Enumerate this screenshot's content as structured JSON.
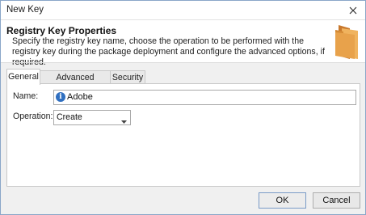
{
  "window": {
    "title": "New Key"
  },
  "header": {
    "title": "Registry Key Properties",
    "description": "Specify the registry key name, choose the operation to be performed with the registry key during the package deployment and configure the advanced options, if required.",
    "icon": "folder-icon"
  },
  "tabs": [
    {
      "label": "General",
      "active": true
    },
    {
      "label": "Advanced Options",
      "active": false
    },
    {
      "label": "Security",
      "active": false
    }
  ],
  "form": {
    "name_label": "Name:",
    "name_value": "Adobe",
    "operation_label": "Operation:",
    "operation_value": "Create"
  },
  "buttons": {
    "ok": "OK",
    "cancel": "Cancel"
  },
  "colors": {
    "info_icon": "#2f6fc0",
    "folder": "#e8a24b",
    "ok_border": "#7a9bc7"
  }
}
